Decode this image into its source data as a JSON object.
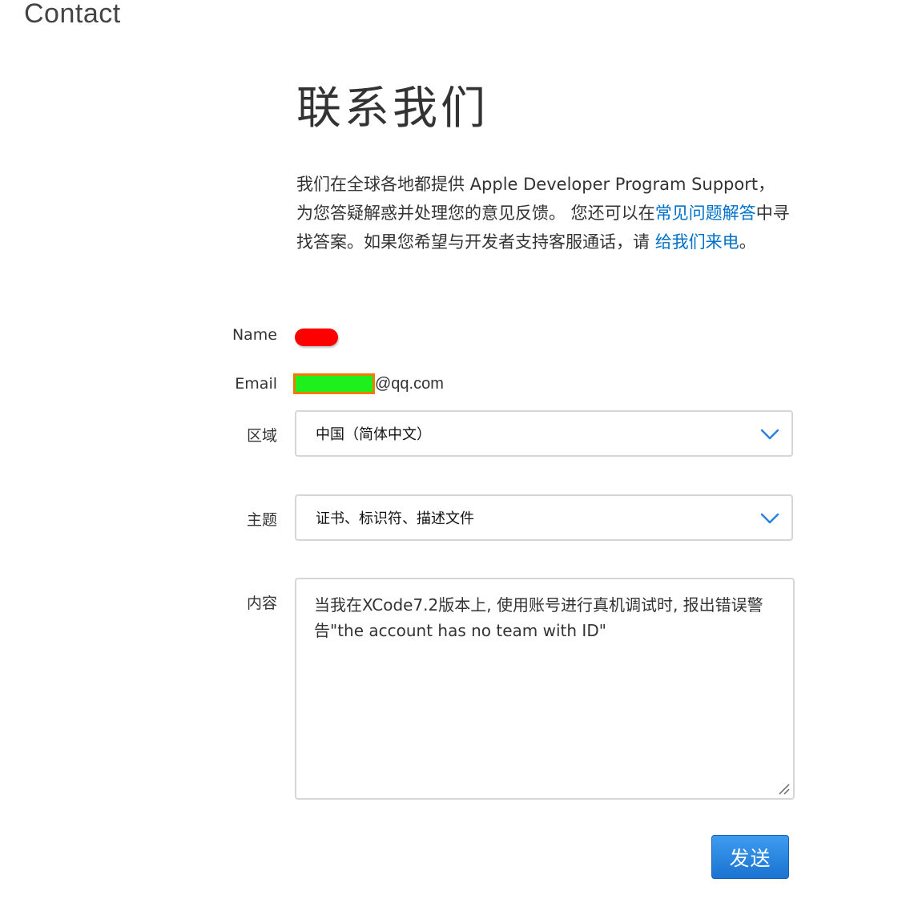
{
  "header": {
    "section_title": "Contact"
  },
  "main": {
    "title": "联系我们",
    "intro": {
      "text_1": "我们在全球各地都提供 Apple Developer Program Support，为您答疑解惑并处理您的意见反馈。 您还可以在",
      "faq_link": "常见问题解答",
      "text_2": "中寻找答案。如果您希望与开发者支持客服通话，请 ",
      "call_link": "给我们来电",
      "text_3": "。"
    }
  },
  "form": {
    "name": {
      "label": "Name"
    },
    "email": {
      "label": "Email",
      "domain": "@qq.com"
    },
    "region": {
      "label": "区域",
      "selected": "中国（简体中文）"
    },
    "topic": {
      "label": "主题",
      "selected": "证书、标识符、描述文件"
    },
    "content": {
      "label": "内容",
      "value": "当我在XCode7.2版本上, 使用账号进行真机调试时, 报出错误警告\"the account has no team with ID\""
    },
    "submit_label": "发送"
  },
  "colors": {
    "link": "#0070c9",
    "button": "#2a82e0",
    "chevron": "#2a82e0",
    "redaction_red": "#ff0000",
    "redaction_green": "#1ef01e",
    "redaction_orange": "#f07c00"
  },
  "icons": {
    "dropdown": "chevron-down-icon",
    "resize": "resize-handle-icon"
  }
}
